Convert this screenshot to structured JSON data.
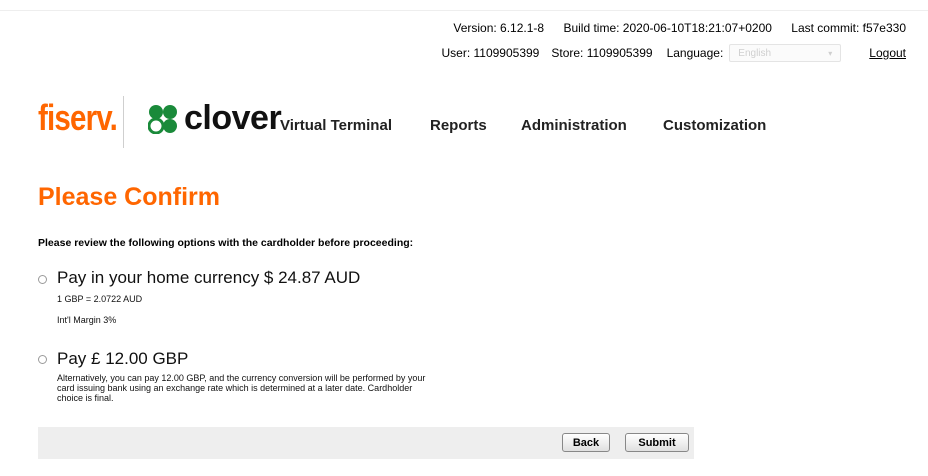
{
  "header": {
    "version": "Version: 6.12.1-8",
    "build_time": "Build time: 2020-06-10T18:21:07+0200",
    "last_commit": "Last commit: f57e330",
    "user": "User: 1109905399",
    "store": "Store: 1109905399",
    "language_label": "Language:",
    "language_value": "English",
    "logout": "Logout"
  },
  "brand": {
    "fiserv": "fiserv.",
    "clover": "clover",
    "fiserv_color": "#ff6600"
  },
  "nav": {
    "virtual_terminal": "Virtual Terminal",
    "reports": "Reports",
    "administration": "Administration",
    "customization": "Customization"
  },
  "page": {
    "title": "Please Confirm",
    "instructions": "Please review the following options with the cardholder before proceeding:"
  },
  "options": {
    "home": {
      "title": "Pay in your home currency $ 24.87 AUD",
      "rate": "1 GBP = 2.0722 AUD",
      "margin": "Int'l Margin 3%"
    },
    "local": {
      "title": "Pay £ 12.00 GBP",
      "description": "Alternatively, you can pay 12.00 GBP, and the currency conversion will be performed by your card issuing bank using an exchange rate which is determined at a later date. Cardholder choice is final."
    }
  },
  "actions": {
    "back": "Back",
    "submit": "Submit"
  }
}
